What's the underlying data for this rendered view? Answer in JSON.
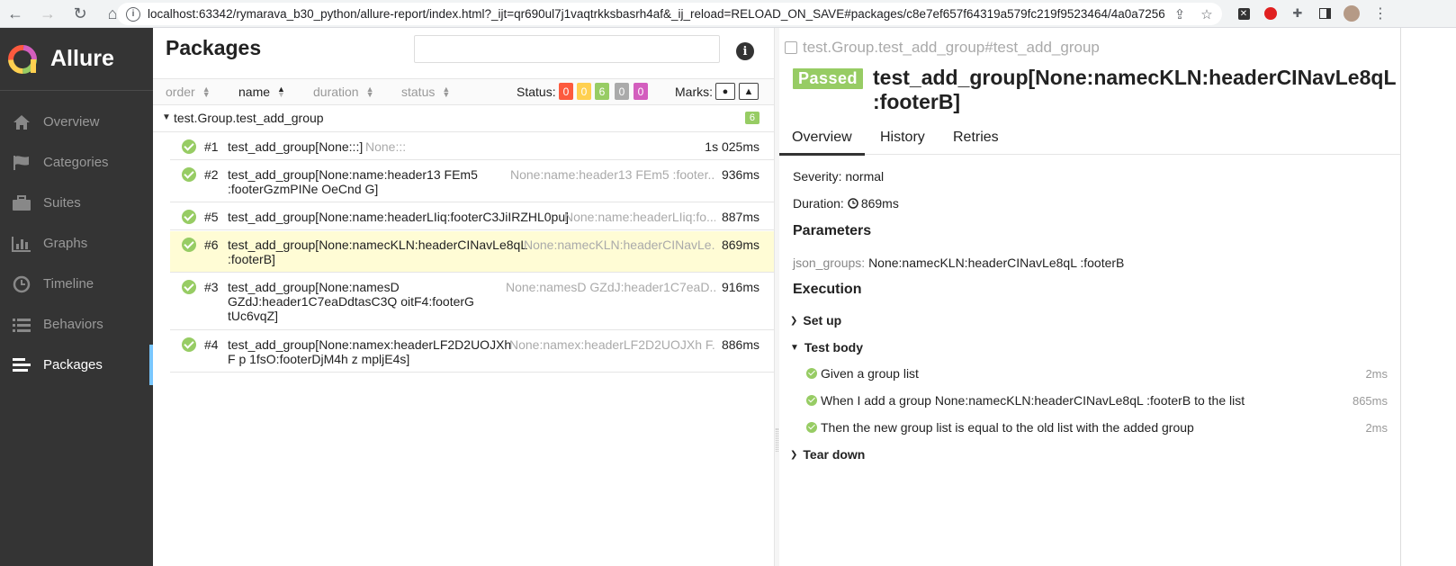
{
  "browser": {
    "url": "localhost:63342/rymarava_b30_python/allure-report/index.html?_ijt=qr690ul7j1vaqtrkksbasrh4af&_ij_reload=RELOAD_ON_SAVE#packages/c8e7ef657f64319a579fc219f9523464/4a0a7256..."
  },
  "sidebar": {
    "brand": "Allure",
    "items": [
      {
        "label": "Overview"
      },
      {
        "label": "Categories"
      },
      {
        "label": "Suites"
      },
      {
        "label": "Graphs"
      },
      {
        "label": "Timeline"
      },
      {
        "label": "Behaviors"
      },
      {
        "label": "Packages"
      }
    ]
  },
  "packages": {
    "title": "Packages",
    "sort": {
      "order": "order",
      "name": "name",
      "duration": "duration",
      "status": "status"
    },
    "status_label": "Status:",
    "status_counts": [
      {
        "value": "0",
        "color": "#fd5a3e"
      },
      {
        "value": "0",
        "color": "#ffd050"
      },
      {
        "value": "6",
        "color": "#97cc64"
      },
      {
        "value": "0",
        "color": "#aaaaaa"
      },
      {
        "value": "0",
        "color": "#d35ebe"
      }
    ],
    "marks_label": "Marks:",
    "group": {
      "name": "test.Group.test_add_group",
      "count": "6"
    },
    "rows": [
      {
        "num": "#1",
        "name": "test_add_group[None:::]",
        "param": "None:::",
        "duration": "1s 025ms"
      },
      {
        "num": "#2",
        "name": "test_add_group[None:name:header13 FEm5 :footerGzmPINe OeCnd G]",
        "param": "None:name:header13 FEm5 :footer...",
        "duration": "936ms"
      },
      {
        "num": "#5",
        "name": "test_add_group[None:name:headerLIiq:footerC3JiIRZHL0pu]",
        "param": "None:name:headerLIiq:fo...",
        "duration": "887ms"
      },
      {
        "num": "#6",
        "name": "test_add_group[None:namecKLN:headerCINavLe8qL :footerB]",
        "param": "None:namecKLN:headerCINavLe...",
        "duration": "869ms"
      },
      {
        "num": "#3",
        "name": "test_add_group[None:namesD GZdJ:header1C7eaDdtasC3Q oitF4:footerG tUc6vqZ]",
        "param": "None:namesD GZdJ:header1C7eaD...",
        "duration": "916ms"
      },
      {
        "num": "#4",
        "name": "test_add_group[None:namex:headerLF2D2UOJXh F p 1fsO:footerDjM4h z mpljE4s]",
        "param": "None:namex:headerLF2D2UOJXh F...",
        "duration": "886ms"
      }
    ]
  },
  "details": {
    "breadcrumb": "test.Group.test_add_group#test_add_group",
    "status": "Passed",
    "title": "test_add_group[None:namecKLN:headerCINavLe8qL :footerB]",
    "tabs": [
      "Overview",
      "History",
      "Retries"
    ],
    "severity_label": "Severity:",
    "severity": "normal",
    "duration_label": "Duration:",
    "duration": "869ms",
    "parameters_title": "Parameters",
    "param_key": "json_groups:",
    "param_value": "None:namecKLN:headerCINavLe8qL :footerB",
    "execution_title": "Execution",
    "setup": "Set up",
    "test_body": "Test body",
    "steps": [
      {
        "text": "Given a group list",
        "duration": "2ms"
      },
      {
        "text": "When I add a group None:namecKLN:headerCINavLe8qL :footerB to the list",
        "duration": "865ms"
      },
      {
        "text": "Then the new group list is equal to the old list with the added group",
        "duration": "2ms"
      }
    ],
    "teardown": "Tear down"
  }
}
